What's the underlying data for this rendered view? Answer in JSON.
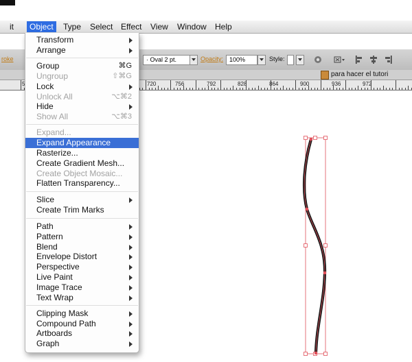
{
  "menubar": {
    "items": [
      {
        "label": "it"
      },
      {
        "label": "Object"
      },
      {
        "label": "Type"
      },
      {
        "label": "Select"
      },
      {
        "label": "Effect"
      },
      {
        "label": "View"
      },
      {
        "label": "Window"
      },
      {
        "label": "Help"
      }
    ],
    "active": "Object"
  },
  "control_bar": {
    "left_label": "roke",
    "stroke_profile": "Oval 2 pt.",
    "opacity_label": "Opacity:",
    "opacity_value": "100%",
    "style_label": "Style:"
  },
  "document_tab": {
    "title": "para hacer el tutori"
  },
  "ruler": {
    "first_label": "5",
    "labels": [
      "720",
      "756",
      "792",
      "828",
      "864",
      "900",
      "936",
      "972"
    ]
  },
  "object_menu": {
    "items": [
      {
        "label": "Transform",
        "submenu": true
      },
      {
        "label": "Arrange",
        "submenu": true
      },
      {
        "label": "Group",
        "shortcut": "⌘G"
      },
      {
        "label": "Ungroup",
        "shortcut": "⇧⌘G",
        "disabled": true
      },
      {
        "label": "Lock",
        "submenu": true
      },
      {
        "label": "Unlock All",
        "shortcut": "⌥⌘2",
        "disabled": true
      },
      {
        "label": "Hide",
        "submenu": true
      },
      {
        "label": "Show All",
        "shortcut": "⌥⌘3",
        "disabled": true
      },
      {
        "label": "Expand...",
        "disabled": true
      },
      {
        "label": "Expand Appearance",
        "highlighted": true
      },
      {
        "label": "Rasterize..."
      },
      {
        "label": "Create Gradient Mesh..."
      },
      {
        "label": "Create Object Mosaic...",
        "disabled": true
      },
      {
        "label": "Flatten Transparency..."
      },
      {
        "label": "Slice",
        "submenu": true
      },
      {
        "label": "Create Trim Marks"
      },
      {
        "label": "Path",
        "submenu": true
      },
      {
        "label": "Pattern",
        "submenu": true
      },
      {
        "label": "Blend",
        "submenu": true
      },
      {
        "label": "Envelope Distort",
        "submenu": true
      },
      {
        "label": "Perspective",
        "submenu": true
      },
      {
        "label": "Live Paint",
        "submenu": true
      },
      {
        "label": "Image Trace",
        "submenu": true
      },
      {
        "label": "Text Wrap",
        "submenu": true
      },
      {
        "label": "Clipping Mask",
        "submenu": true
      },
      {
        "label": "Compound Path",
        "submenu": true
      },
      {
        "label": "Artboards",
        "submenu": true
      },
      {
        "label": "Graph",
        "submenu": true
      }
    ]
  },
  "colors": {
    "menu_highlight": "#3a6fd6",
    "menubar_active": "#2f6de2",
    "selection_bbox": "#e0505a",
    "stroke": "#1a1a1a"
  },
  "icons": {
    "arrow": "chevron-right-icon",
    "doc": "document-icon"
  }
}
